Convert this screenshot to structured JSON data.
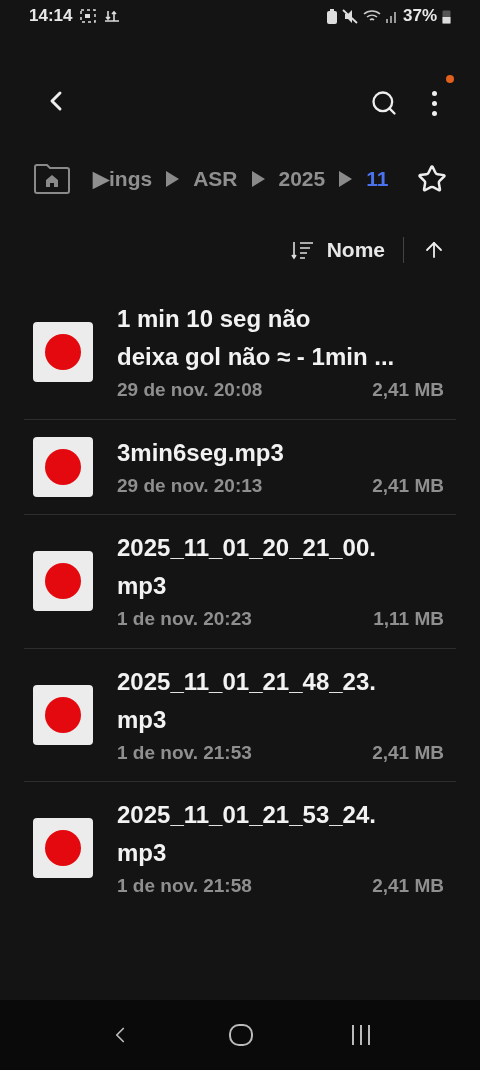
{
  "status_bar": {
    "time": "14:14",
    "battery": "37%"
  },
  "top_bar": {
    "notification_dot": true
  },
  "breadcrumb": [
    {
      "label": "▶ings",
      "selected": false
    },
    {
      "label": "ASR",
      "selected": false
    },
    {
      "label": "2025",
      "selected": false
    },
    {
      "label": "11",
      "selected": true
    }
  ],
  "sort": {
    "label": "Nome"
  },
  "files": [
    {
      "title_lines": [
        "1 min 10 seg não",
        "deixa gol não ≈ - 1min ..."
      ],
      "date": "29 de nov. 20:08",
      "size": "2,41 MB"
    },
    {
      "title_lines": [
        "3min6seg.mp3"
      ],
      "date": "29 de nov. 20:13",
      "size": "2,41 MB"
    },
    {
      "title_lines": [
        "2025_11_01_20_21_00.",
        "mp3"
      ],
      "date": "1 de nov. 20:23",
      "size": "1,11 MB"
    },
    {
      "title_lines": [
        "2025_11_01_21_48_23.",
        "mp3"
      ],
      "date": "1 de nov. 21:53",
      "size": "2,41 MB"
    },
    {
      "title_lines": [
        "2025_11_01_21_53_24.",
        "mp3"
      ],
      "date": "1 de nov. 21:58",
      "size": "2,41 MB"
    }
  ]
}
